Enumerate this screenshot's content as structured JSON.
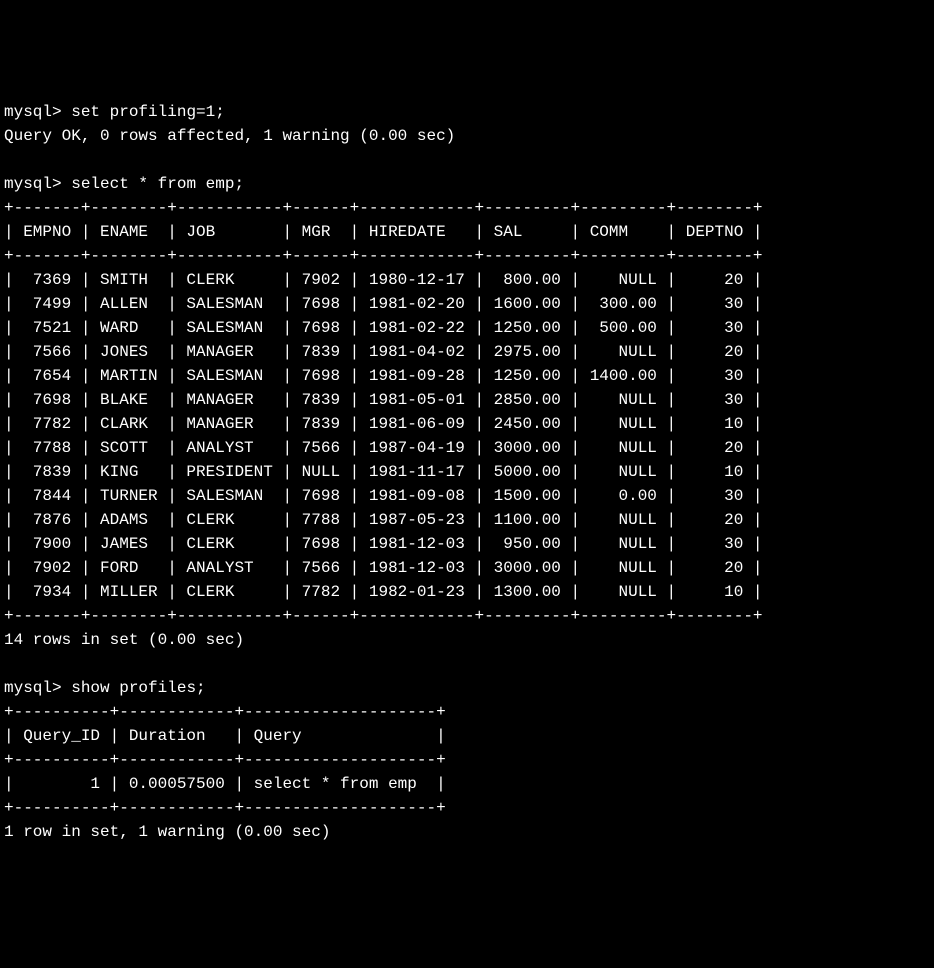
{
  "prompts": {
    "mysql": "mysql>"
  },
  "commands": {
    "cmd1": "set profiling=1;",
    "result1": "Query OK, 0 rows affected, 1 warning (0.00 sec)",
    "cmd2": "select * from emp;",
    "cmd3": "show profiles;"
  },
  "table1": {
    "border_top": "+-------+--------+-----------+------+------------+---------+---------+--------+",
    "header": "| EMPNO | ENAME  | JOB       | MGR  | HIREDATE   | SAL     | COMM    | DEPTNO |",
    "border_mid": "+-------+--------+-----------+------+------------+---------+---------+--------+",
    "rows": [
      "|  7369 | SMITH  | CLERK     | 7902 | 1980-12-17 |  800.00 |    NULL |     20 |",
      "|  7499 | ALLEN  | SALESMAN  | 7698 | 1981-02-20 | 1600.00 |  300.00 |     30 |",
      "|  7521 | WARD   | SALESMAN  | 7698 | 1981-02-22 | 1250.00 |  500.00 |     30 |",
      "|  7566 | JONES  | MANAGER   | 7839 | 1981-04-02 | 2975.00 |    NULL |     20 |",
      "|  7654 | MARTIN | SALESMAN  | 7698 | 1981-09-28 | 1250.00 | 1400.00 |     30 |",
      "|  7698 | BLAKE  | MANAGER   | 7839 | 1981-05-01 | 2850.00 |    NULL |     30 |",
      "|  7782 | CLARK  | MANAGER   | 7839 | 1981-06-09 | 2450.00 |    NULL |     10 |",
      "|  7788 | SCOTT  | ANALYST   | 7566 | 1987-04-19 | 3000.00 |    NULL |     20 |",
      "|  7839 | KING   | PRESIDENT | NULL | 1981-11-17 | 5000.00 |    NULL |     10 |",
      "|  7844 | TURNER | SALESMAN  | 7698 | 1981-09-08 | 1500.00 |    0.00 |     30 |",
      "|  7876 | ADAMS  | CLERK     | 7788 | 1987-05-23 | 1100.00 |    NULL |     20 |",
      "|  7900 | JAMES  | CLERK     | 7698 | 1981-12-03 |  950.00 |    NULL |     30 |",
      "|  7902 | FORD   | ANALYST   | 7566 | 1981-12-03 | 3000.00 |    NULL |     20 |",
      "|  7934 | MILLER | CLERK     | 7782 | 1982-01-23 | 1300.00 |    NULL |     10 |"
    ],
    "border_bot": "+-------+--------+-----------+------+------------+---------+---------+--------+",
    "summary": "14 rows in set (0.00 sec)"
  },
  "table2": {
    "border_top": "+----------+------------+--------------------+",
    "header": "| Query_ID | Duration   | Query              |",
    "border_mid": "+----------+------------+--------------------+",
    "rows": [
      "|        1 | 0.00057500 | select * from emp  |"
    ],
    "border_bot": "+----------+------------+--------------------+",
    "summary": "1 row in set, 1 warning (0.00 sec)"
  },
  "chart_data": {
    "type": "table",
    "tables": [
      {
        "name": "emp",
        "columns": [
          "EMPNO",
          "ENAME",
          "JOB",
          "MGR",
          "HIREDATE",
          "SAL",
          "COMM",
          "DEPTNO"
        ],
        "rows": [
          [
            7369,
            "SMITH",
            "CLERK",
            7902,
            "1980-12-17",
            800.0,
            null,
            20
          ],
          [
            7499,
            "ALLEN",
            "SALESMAN",
            7698,
            "1981-02-20",
            1600.0,
            300.0,
            30
          ],
          [
            7521,
            "WARD",
            "SALESMAN",
            7698,
            "1981-02-22",
            1250.0,
            500.0,
            30
          ],
          [
            7566,
            "JONES",
            "MANAGER",
            7839,
            "1981-04-02",
            2975.0,
            null,
            20
          ],
          [
            7654,
            "MARTIN",
            "SALESMAN",
            7698,
            "1981-09-28",
            1250.0,
            1400.0,
            30
          ],
          [
            7698,
            "BLAKE",
            "MANAGER",
            7839,
            "1981-05-01",
            2850.0,
            null,
            30
          ],
          [
            7782,
            "CLARK",
            "MANAGER",
            7839,
            "1981-06-09",
            2450.0,
            null,
            10
          ],
          [
            7788,
            "SCOTT",
            "ANALYST",
            7566,
            "1987-04-19",
            3000.0,
            null,
            20
          ],
          [
            7839,
            "KING",
            "PRESIDENT",
            null,
            "1981-11-17",
            5000.0,
            null,
            10
          ],
          [
            7844,
            "TURNER",
            "SALESMAN",
            7698,
            "1981-09-08",
            1500.0,
            0.0,
            30
          ],
          [
            7876,
            "ADAMS",
            "CLERK",
            7788,
            "1987-05-23",
            1100.0,
            null,
            20
          ],
          [
            7900,
            "JAMES",
            "CLERK",
            7698,
            "1981-12-03",
            950.0,
            null,
            30
          ],
          [
            7902,
            "FORD",
            "ANALYST",
            7566,
            "1981-12-03",
            3000.0,
            null,
            20
          ],
          [
            7934,
            "MILLER",
            "CLERK",
            7782,
            "1982-01-23",
            1300.0,
            null,
            10
          ]
        ]
      },
      {
        "name": "profiles",
        "columns": [
          "Query_ID",
          "Duration",
          "Query"
        ],
        "rows": [
          [
            1,
            0.000575,
            "select * from emp"
          ]
        ]
      }
    ]
  }
}
